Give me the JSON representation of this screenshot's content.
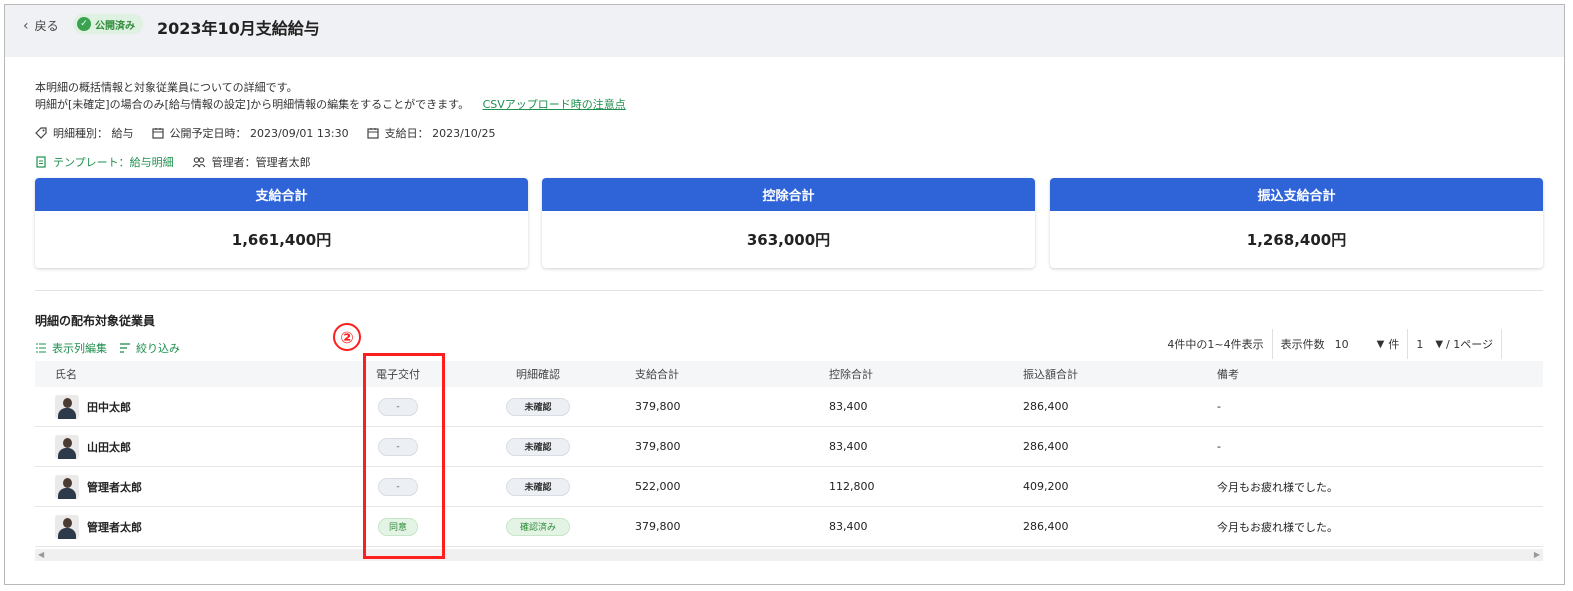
{
  "header": {
    "back_label": "戻る",
    "status_badge": "公開済み",
    "title": "2023年10月支給給与"
  },
  "description": {
    "line1": "本明細の概括情報と対象従業員についての詳細です。",
    "line2": "明細が[未確定]の場合のみ[給与情報の設定]から明細情報の編集をすることができます。",
    "csv_link": "CSVアップロード時の注意点"
  },
  "meta": {
    "type": "明細種別： 給与",
    "publish_at": "公開予定日時： 2023/09/01 13:30",
    "pay_date": "支給日： 2023/10/25",
    "template": "テンプレート：給与明細",
    "manager": "管理者：管理者太郎"
  },
  "summary_cards": [
    {
      "label": "支給合計",
      "value": "1,661,400円"
    },
    {
      "label": "控除合計",
      "value": "363,000円"
    },
    {
      "label": "振込支給合計",
      "value": "1,268,400円"
    }
  ],
  "section": {
    "title": "明細の配布対象従業員",
    "marker": "②",
    "edit_columns": "表示列編集",
    "filter": "絞り込み"
  },
  "pager": {
    "range_text": "4件中の1~4件表示",
    "per_page_label": "表示件数",
    "per_page_value": "10",
    "per_page_unit": "件",
    "page_value": "1",
    "page_total": "/ 1ページ"
  },
  "table": {
    "columns": [
      "氏名",
      "電子交付",
      "明細確認",
      "支給合計",
      "控除合計",
      "振込額合計",
      "備考"
    ],
    "rows": [
      {
        "name": "田中太郎",
        "e_delivery": "-",
        "confirm": "未確認",
        "pay_total": "379,800",
        "deduction_total": "83,400",
        "transfer_total": "286,400",
        "note": "-"
      },
      {
        "name": "山田太郎",
        "e_delivery": "-",
        "confirm": "未確認",
        "pay_total": "379,800",
        "deduction_total": "83,400",
        "transfer_total": "286,400",
        "note": "-"
      },
      {
        "name": "管理者太郎",
        "e_delivery": "-",
        "confirm": "未確認",
        "pay_total": "522,000",
        "deduction_total": "112,800",
        "transfer_total": "409,200",
        "note": "今月もお疲れ様でした。"
      },
      {
        "name": "管理者太郎",
        "e_delivery": "同意",
        "confirm": "確認済み",
        "pay_total": "379,800",
        "deduction_total": "83,400",
        "transfer_total": "286,400",
        "note": "今月もお疲れ様でした。"
      }
    ]
  },
  "colors": {
    "accent_blue": "#2f64d8",
    "link_green": "#1e8f4e",
    "highlight_red": "#ff1e1e"
  },
  "icons": [
    "chevron-left-icon",
    "check-circle-icon",
    "tag-icon",
    "calendar-icon",
    "document-icon",
    "users-icon",
    "columns-icon",
    "filter-icon",
    "triangle-down-icon"
  ]
}
